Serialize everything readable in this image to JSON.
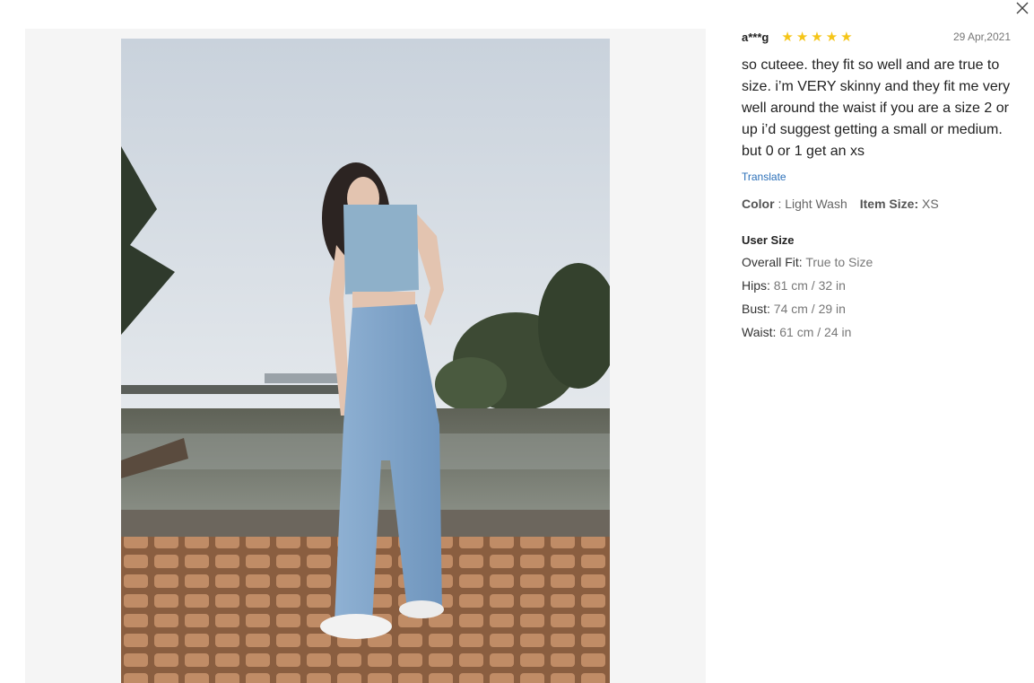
{
  "review": {
    "username": "a***g",
    "rating": 5,
    "date": "29 Apr,2021",
    "text": "so cuteee. they fit so well and are true to size. i’m VERY skinny and they fit me very well around the waist if you are a size 2 or up i’d suggest getting a small or medium. but 0 or 1 get an xs",
    "translate_label": "Translate",
    "color_label": "Color",
    "color_sep": " : ",
    "color_value": "Light Wash",
    "item_size_label": "Item Size:",
    "item_size_value": "XS"
  },
  "user_size": {
    "title": "User Size",
    "rows": [
      {
        "label": "Overall Fit:",
        "value": "True to Size"
      },
      {
        "label": "Hips:",
        "value": "81 cm / 32 in"
      },
      {
        "label": "Bust:",
        "value": "74 cm / 29 in"
      },
      {
        "label": "Waist:",
        "value": "61 cm / 24 in"
      }
    ]
  },
  "icons": {
    "close": "close-icon",
    "star": "star-icon"
  },
  "colors": {
    "star": "#f5c518",
    "link": "#2a6fb8",
    "panel_bg": "#f5f5f5"
  }
}
